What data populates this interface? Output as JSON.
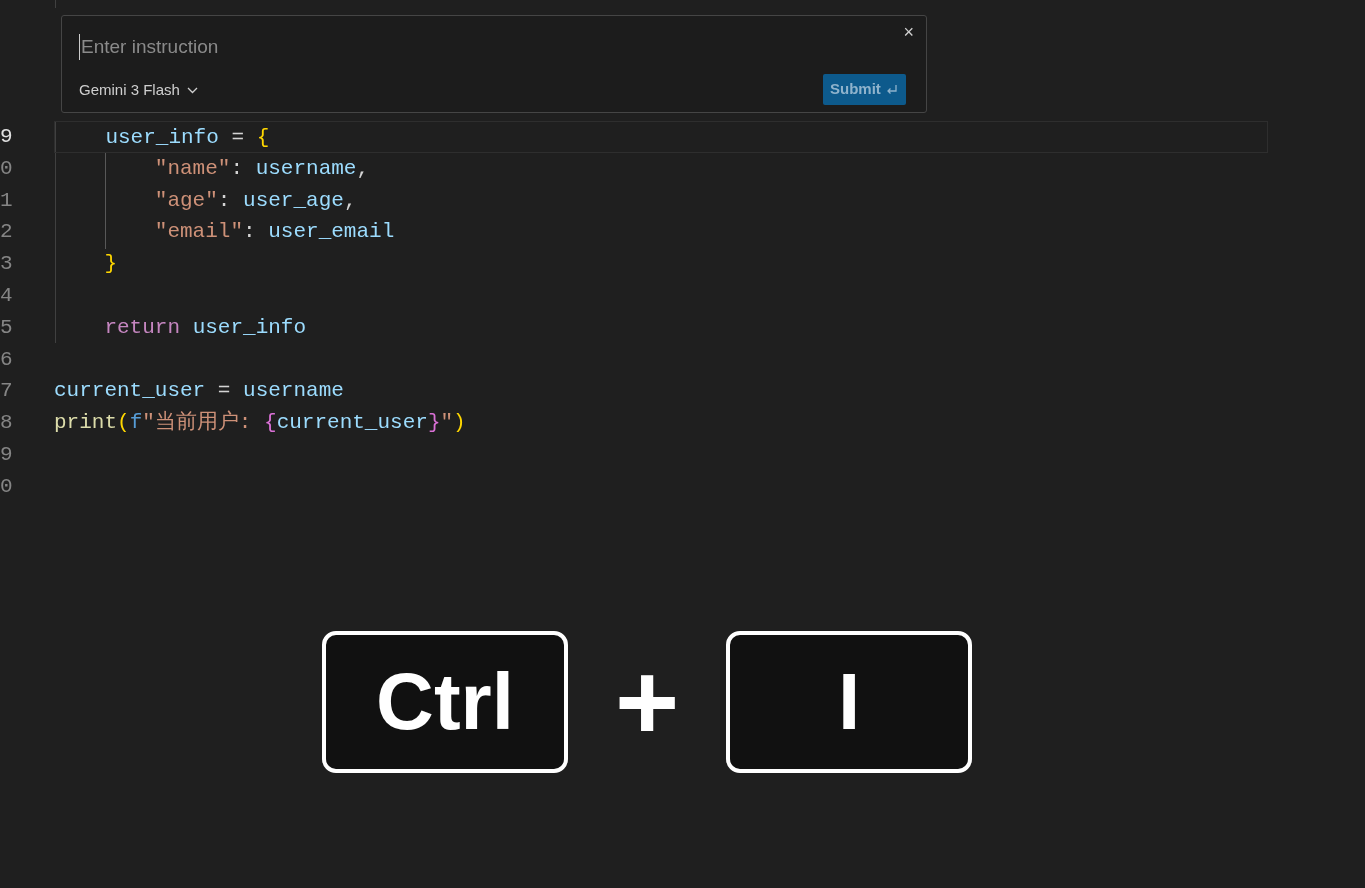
{
  "inline_chat": {
    "placeholder": "Enter instruction",
    "model": "Gemini 3 Flash",
    "close": "×",
    "submit": {
      "label": "Submit",
      "disabled": true
    }
  },
  "editor": {
    "lines": [
      {
        "number": "9",
        "current": true,
        "tokens": [
          {
            "kind": "var",
            "text": "    user_info"
          },
          {
            "kind": "op",
            "text": " = "
          },
          {
            "kind": "brace",
            "text": "{"
          }
        ]
      },
      {
        "number": "0",
        "current": false,
        "tokens": [
          {
            "kind": "str",
            "text": "        \"name\""
          },
          {
            "kind": "op",
            "text": ": "
          },
          {
            "kind": "var",
            "text": "username"
          },
          {
            "kind": "op",
            "text": ","
          }
        ]
      },
      {
        "number": "1",
        "current": false,
        "tokens": [
          {
            "kind": "str",
            "text": "        \"age\""
          },
          {
            "kind": "op",
            "text": ": "
          },
          {
            "kind": "var",
            "text": "user_age"
          },
          {
            "kind": "op",
            "text": ","
          }
        ]
      },
      {
        "number": "2",
        "current": false,
        "tokens": [
          {
            "kind": "str",
            "text": "        \"email\""
          },
          {
            "kind": "op",
            "text": ": "
          },
          {
            "kind": "var",
            "text": "user_email"
          }
        ]
      },
      {
        "number": "3",
        "current": false,
        "tokens": [
          {
            "kind": "brace",
            "text": "    }"
          }
        ]
      },
      {
        "number": "4",
        "current": false
      },
      {
        "number": "5",
        "current": false,
        "tokens": [
          {
            "kind": "keyword",
            "text": "    return "
          },
          {
            "kind": "var",
            "text": "user_info"
          }
        ]
      },
      {
        "number": "6",
        "current": false
      },
      {
        "number": "7",
        "current": false,
        "tokens": [
          {
            "kind": "var",
            "text": "current_user"
          },
          {
            "kind": "op",
            "text": " = "
          },
          {
            "kind": "var",
            "text": "username"
          }
        ]
      },
      {
        "number": "8",
        "current": false,
        "tokens": [
          {
            "kind": "func",
            "text": "print"
          },
          {
            "kind": "brace",
            "text": "("
          },
          {
            "kind": "prefix",
            "text": "f"
          },
          {
            "kind": "str",
            "text": "\"当前用户: "
          },
          {
            "kind": "interp",
            "text": "{"
          },
          {
            "kind": "var",
            "text": "current_user"
          },
          {
            "kind": "interp",
            "text": "}"
          },
          {
            "kind": "str",
            "text": "\""
          },
          {
            "kind": "brace",
            "text": ")"
          }
        ]
      },
      {
        "number": "9",
        "current": false
      },
      {
        "number": "0",
        "current": false
      }
    ]
  },
  "shortcut": {
    "keys": [
      "Ctrl",
      "I"
    ],
    "separator": "+"
  }
}
